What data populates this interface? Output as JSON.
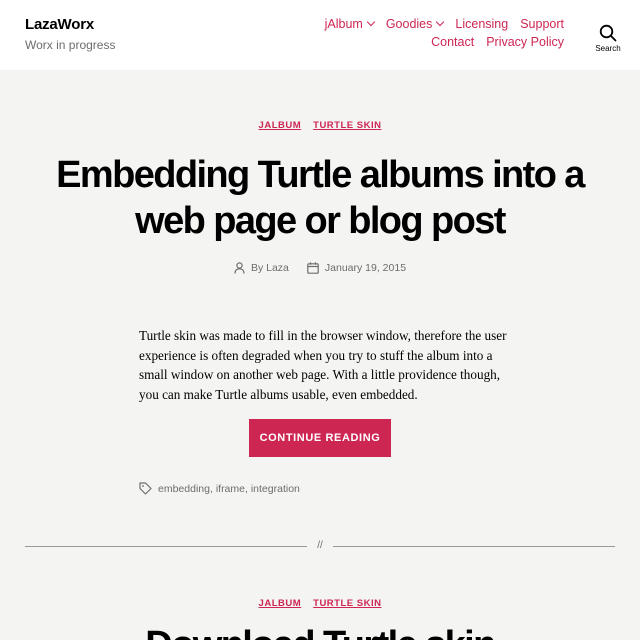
{
  "site": {
    "title": "LazaWorx",
    "description": "Worx in progress"
  },
  "nav": {
    "items": [
      {
        "label": "jAlbum",
        "has_dropdown": true
      },
      {
        "label": "Goodies",
        "has_dropdown": true
      },
      {
        "label": "Licensing",
        "has_dropdown": false
      },
      {
        "label": "Support",
        "has_dropdown": false
      },
      {
        "label": "Contact",
        "has_dropdown": false
      },
      {
        "label": "Privacy Policy",
        "has_dropdown": false
      }
    ],
    "search_label": "Search"
  },
  "post": {
    "categories": [
      "JALBUM",
      "TURTLE SKIN"
    ],
    "title": "Embedding Turtle albums into a web page or blog post",
    "author": "By Laza",
    "date": "January 19, 2015",
    "excerpt": "Turtle skin was made to fill in the browser window, therefore the user experience is often degraded when you try to stuff the album into a small window on another web page. With a little providence though, you can make Turtle albums usable, even embedded.",
    "continue_label": "CONTINUE READING",
    "tags": [
      "embedding",
      "iframe",
      "integration"
    ]
  },
  "separator": "//",
  "next_post": {
    "categories": [
      "JALBUM",
      "TURTLE SKIN"
    ],
    "title_partial": "Download Turtle skin"
  },
  "colors": {
    "accent": "#cd2653",
    "background": "#f4f4f2",
    "header_bg": "#ffffff",
    "muted_text": "#6d6d6d"
  }
}
